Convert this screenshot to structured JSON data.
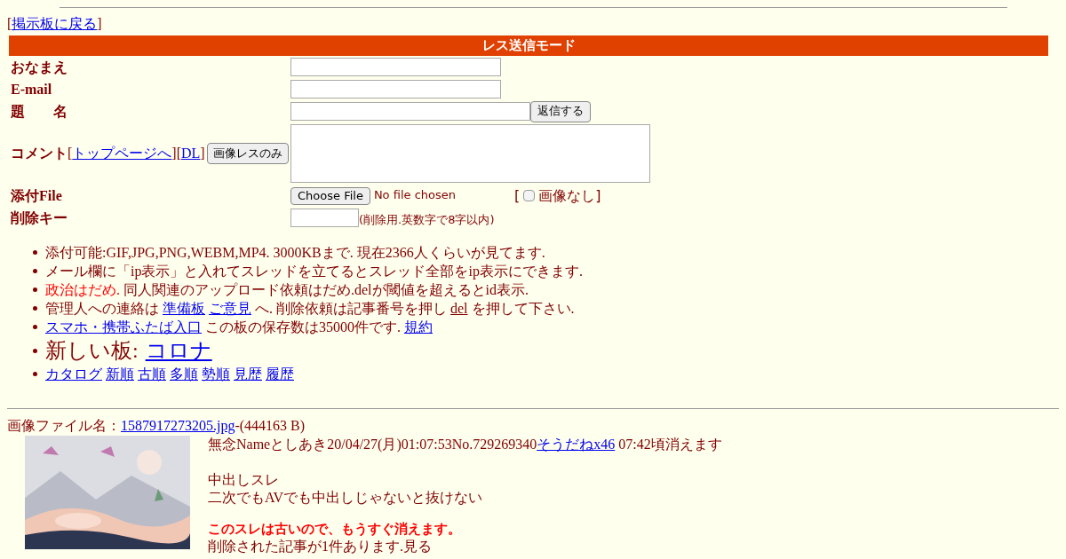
{
  "back_link": {
    "before": "[",
    "label": "掲示板に戻る",
    "after": "]"
  },
  "form": {
    "header": "レス送信モード",
    "rows": [
      {
        "kind": "text",
        "label": "おなまえ"
      },
      {
        "kind": "text",
        "label": "E-mail"
      },
      {
        "kind": "text_button",
        "label": "題　　名",
        "button": "返信する"
      },
      {
        "kind": "textarea",
        "label": "コメント",
        "links": [
          {
            "before": "[",
            "label": "トップページへ",
            "after": "]"
          },
          {
            "before": "[",
            "label": "DL",
            "after": "]"
          }
        ],
        "button": "画像レスのみ"
      },
      {
        "kind": "file",
        "label": "添付File",
        "button": "Choose File",
        "status": "No file chosen",
        "checkbox": {
          "before": "[",
          "label": "画像なし",
          "after": "]",
          "checked": false
        }
      },
      {
        "kind": "password",
        "label": "削除キー",
        "note": "(削除用.英数字で8字以内)"
      }
    ]
  },
  "notices": [
    {
      "kind": "normal",
      "segments": [
        {
          "kind": "plain",
          "text": "添付可能:GIF,JPG,PNG,WEBM,MP4. 3000KBまで. 現在2366人くらいが見てます."
        }
      ]
    },
    {
      "kind": "normal",
      "segments": [
        {
          "kind": "plain",
          "text": "メール欄に「ip表示」と入れてスレッドを立てるとスレッド全部をip表示にできます."
        }
      ]
    },
    {
      "kind": "normal",
      "segments": [
        {
          "kind": "alert",
          "text": "政治はだめ."
        },
        {
          "kind": "plain",
          "text": " 同人関連のアップロード依頼はだめ.delが閾値を超えるとid表示."
        }
      ]
    },
    {
      "kind": "normal",
      "segments": [
        {
          "kind": "plain",
          "text": "管理人への連絡は"
        },
        {
          "kind": "link",
          "text": "準備板"
        },
        {
          "kind": "link",
          "text": "ご意見"
        },
        {
          "kind": "plain",
          "text": "へ. 削除依頼は記事番号を押し"
        },
        {
          "kind": "plain_link",
          "text": "del"
        },
        {
          "kind": "plain",
          "text": "を押して下さい."
        }
      ]
    },
    {
      "kind": "normal",
      "segments": [
        {
          "kind": "link",
          "text": "スマホ・携帯ふたば入口"
        },
        {
          "kind": "plain",
          "text": "この板の保存数は35000件です."
        },
        {
          "kind": "link",
          "text": "規約"
        }
      ]
    },
    {
      "kind": "large",
      "segments": [
        {
          "kind": "plain",
          "text": "新しい板:"
        },
        {
          "kind": "link",
          "text": "コロナ"
        }
      ]
    },
    {
      "kind": "normal",
      "segments": [
        {
          "kind": "link",
          "text": "カタログ"
        },
        {
          "kind": "link",
          "text": "新順"
        },
        {
          "kind": "link",
          "text": "古順"
        },
        {
          "kind": "link",
          "text": "多順"
        },
        {
          "kind": "link",
          "text": "勢順"
        },
        {
          "kind": "link",
          "text": "見歴"
        },
        {
          "kind": "link",
          "text": "履歴"
        }
      ]
    }
  ],
  "post": {
    "file_label": "画像ファイル名：",
    "file_link": "1587917273205.jpg",
    "file_size": "-(444163 B)",
    "thumbnail": {
      "kind": "picture"
    },
    "header": "無念Nameとしあき20/04/27(月)01:07:53No.729269340",
    "sodane": "そうだねx46",
    "expire": "07:42頃消えます",
    "body": [
      "中出しスレ",
      "二次でもAVでも中出しじゃないと抜けない"
    ],
    "warning": "このスレは古いので、もうすぐ消えます。",
    "deleted": "削除された記事が1件あります.見る"
  }
}
